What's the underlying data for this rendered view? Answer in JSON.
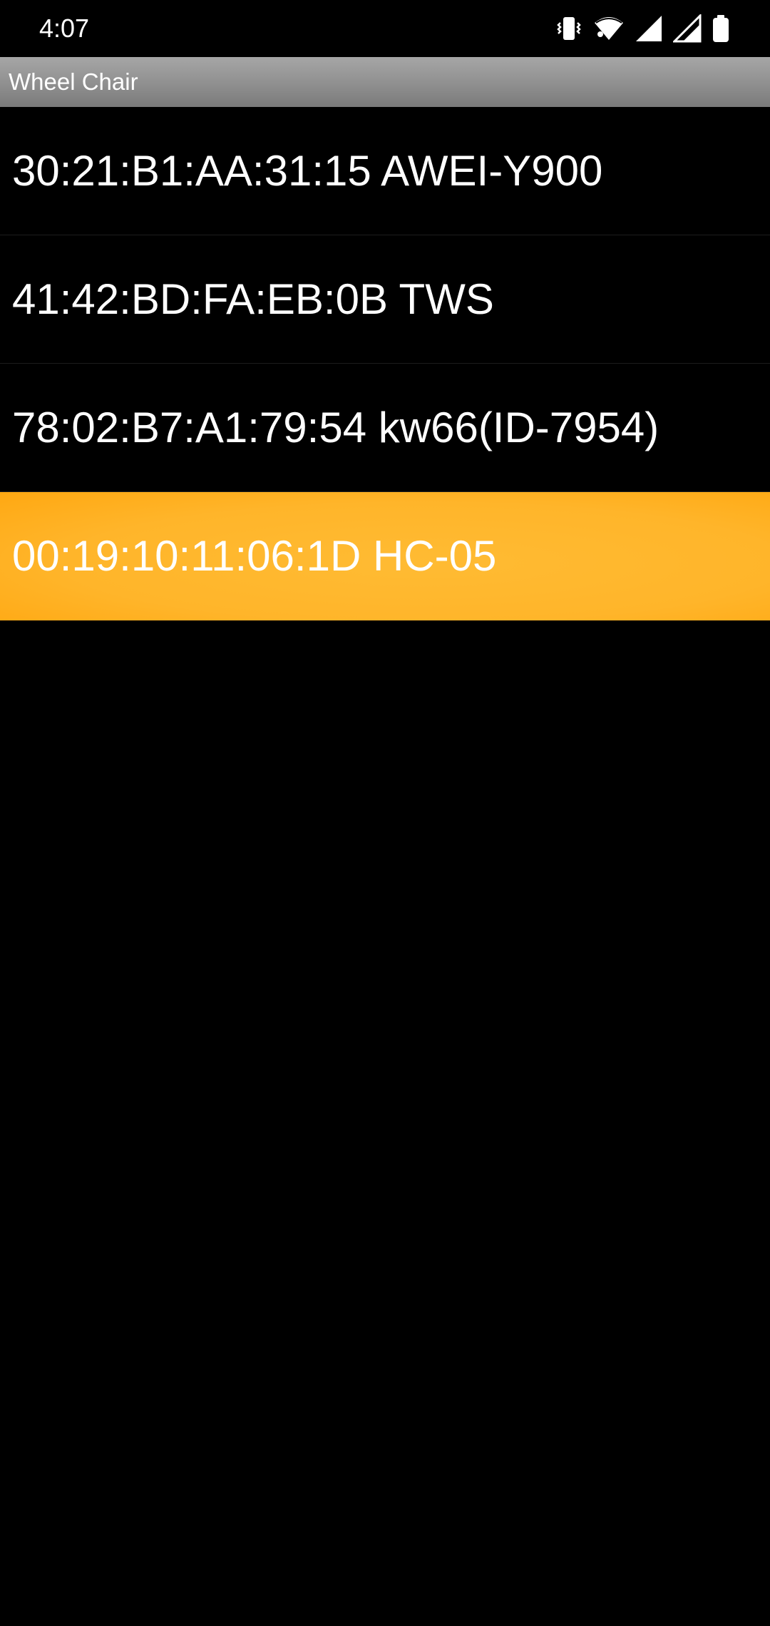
{
  "status_bar": {
    "time": "4:07",
    "icons": [
      "vibrate-icon",
      "wifi-icon",
      "signal-icon",
      "signal-icon",
      "battery-icon"
    ]
  },
  "app": {
    "title": "Wheel Chair"
  },
  "devices": [
    {
      "label": "30:21:B1:AA:31:15 AWEI-Y900",
      "selected": false
    },
    {
      "label": "41:42:BD:FA:EB:0B TWS",
      "selected": false
    },
    {
      "label": "78:02:B7:A1:79:54 kw66(ID-7954)",
      "selected": false
    },
    {
      "label": "00:19:10:11:06:1D HC-05",
      "selected": true
    }
  ],
  "colors": {
    "background": "#000000",
    "title_bar": "#8f8f8f",
    "selected": "#ffb52a",
    "text": "#ffffff"
  }
}
